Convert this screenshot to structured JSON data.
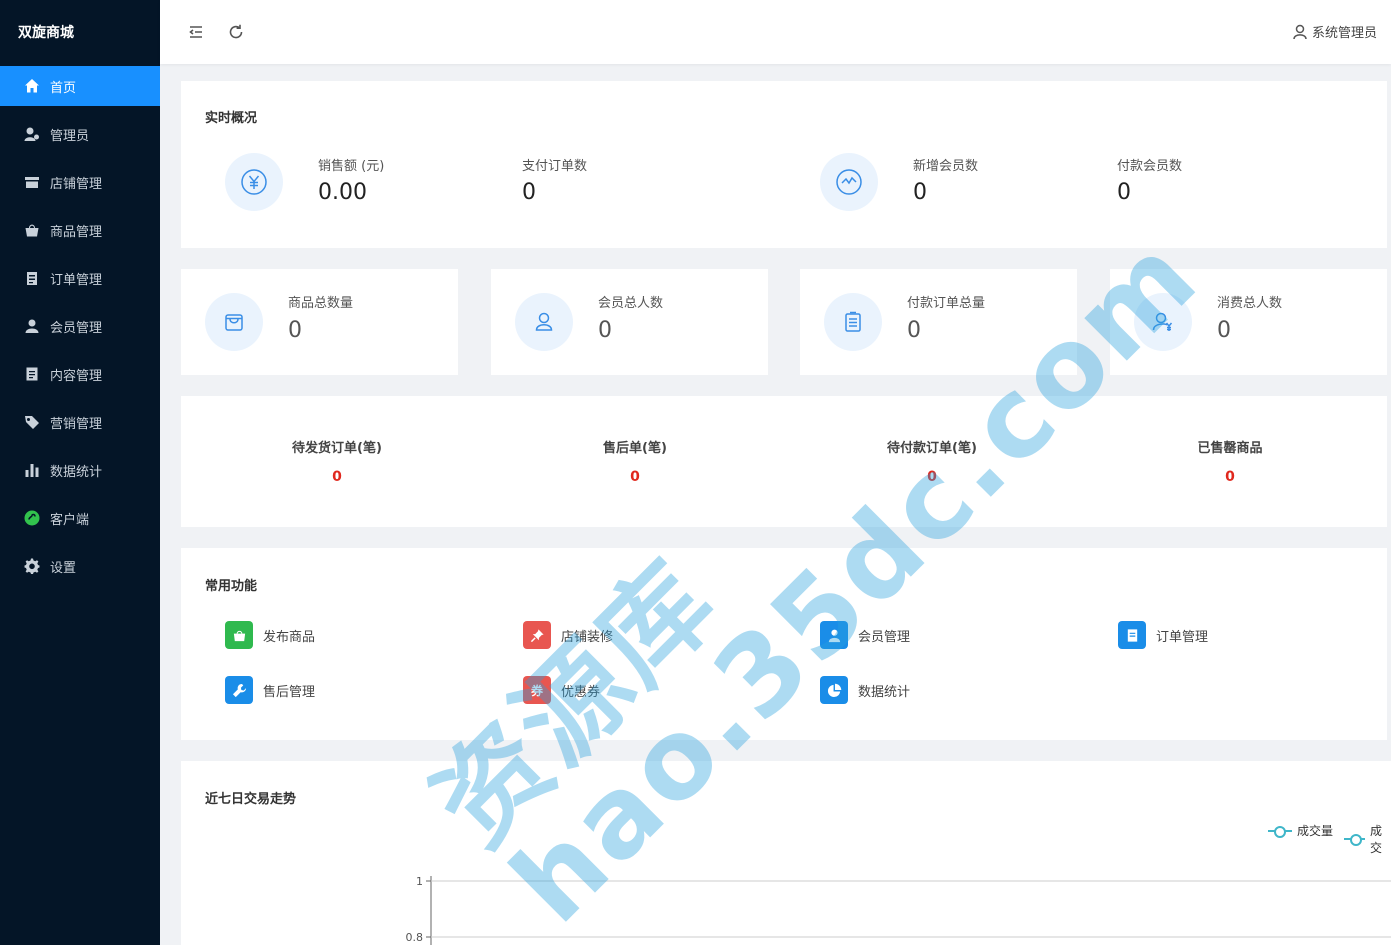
{
  "brand": "双旋商城",
  "sidebar": {
    "items": [
      {
        "label": "首页",
        "icon": "home-icon",
        "active": true
      },
      {
        "label": "管理员",
        "icon": "admin-icon"
      },
      {
        "label": "店铺管理",
        "icon": "store-icon"
      },
      {
        "label": "商品管理",
        "icon": "basket-icon"
      },
      {
        "label": "订单管理",
        "icon": "clipboard-icon"
      },
      {
        "label": "会员管理",
        "icon": "user-icon"
      },
      {
        "label": "内容管理",
        "icon": "document-icon"
      },
      {
        "label": "营销管理",
        "icon": "tag-icon"
      },
      {
        "label": "数据统计",
        "icon": "bar-chart-icon"
      },
      {
        "label": "客户端",
        "icon": "miniprogram-icon"
      },
      {
        "label": "设置",
        "icon": "gear-icon"
      }
    ]
  },
  "header": {
    "user": "系统管理员"
  },
  "overview": {
    "title": "实时概况",
    "stats": [
      {
        "label": "销售额 (元)",
        "value": "0.00"
      },
      {
        "label": "支付订单数",
        "value": "0"
      },
      {
        "label": "新增会员数",
        "value": "0"
      },
      {
        "label": "付款会员数",
        "value": "0"
      }
    ]
  },
  "totals": [
    {
      "label": "商品总数量",
      "value": "0",
      "icon": "bag-icon"
    },
    {
      "label": "会员总人数",
      "value": "0",
      "icon": "member-icon"
    },
    {
      "label": "付款订单总量",
      "value": "0",
      "icon": "order-list-icon"
    },
    {
      "label": "消费总人数",
      "value": "0",
      "icon": "consumer-icon"
    }
  ],
  "todo": [
    {
      "label": "待发货订单(笔)",
      "value": "0"
    },
    {
      "label": "售后单(笔)",
      "value": "0"
    },
    {
      "label": "待付款订单(笔)",
      "value": "0"
    },
    {
      "label": "已售罄商品",
      "value": "0"
    }
  ],
  "functions": {
    "title": "常用功能",
    "items": [
      {
        "label": "发布商品",
        "icon": "bag-icon",
        "color": "#2fb94e"
      },
      {
        "label": "店铺装修",
        "icon": "pin-icon",
        "color": "#e85650"
      },
      {
        "label": "会员管理",
        "icon": "user-icon",
        "color": "#1a8de8"
      },
      {
        "label": "订单管理",
        "icon": "document-icon",
        "color": "#1a8de8"
      },
      {
        "label": "售后管理",
        "icon": "wrench-icon",
        "color": "#1a8de8"
      },
      {
        "label": "优惠券",
        "icon": "coupon-icon",
        "glyph": "券",
        "color": "#e85650"
      },
      {
        "label": "数据统计",
        "icon": "pie-chart-icon",
        "color": "#1a8de8"
      }
    ]
  },
  "trend": {
    "title": "近七日交易走势",
    "legend": [
      "成交量",
      "成交"
    ]
  },
  "chart_data": {
    "type": "line",
    "yticks": [
      "1",
      "0.8"
    ],
    "ylim": [
      0,
      1
    ]
  },
  "watermark": {
    "line1": "资源库",
    "line2": "hao.35dc.com"
  },
  "colors": {
    "sidebar_bg": "#041527",
    "active": "#1890ff",
    "todo_value": "#e0281e",
    "legend_line": "#3fb6c9"
  }
}
